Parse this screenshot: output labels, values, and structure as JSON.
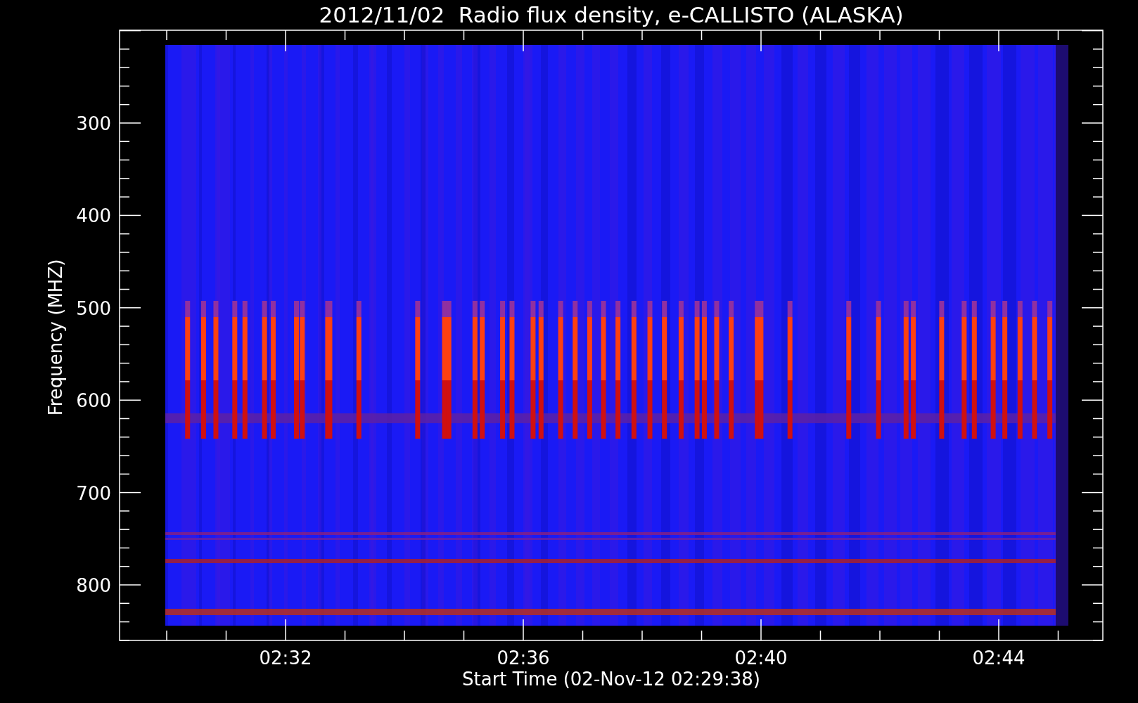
{
  "title": "2012/11/02  Radio flux density, e-CALLISTO (ALASKA)",
  "y_axis": {
    "label": "Frequency (MHZ)",
    "ticks": [
      "300",
      "400",
      "500",
      "600",
      "700",
      "800"
    ]
  },
  "x_axis": {
    "label": "Start Time (02-Nov-12 02:29:38)",
    "ticks": [
      "02:32",
      "02:36",
      "02:40",
      "02:44"
    ]
  }
}
